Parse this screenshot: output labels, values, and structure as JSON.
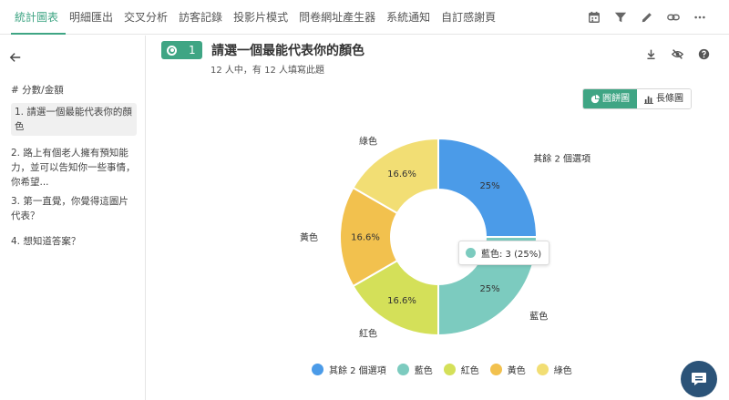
{
  "nav": {
    "tabs": [
      "統計圖表",
      "明細匯出",
      "交叉分析",
      "訪客記錄",
      "投影片模式",
      "問卷網址產生器",
      "系統通知",
      "自訂感謝頁"
    ],
    "active_index": 0,
    "icons": [
      "calendar-icon",
      "filter-icon",
      "pencil-icon",
      "link-icon",
      "more-icon"
    ]
  },
  "sidebar": {
    "items": [
      {
        "num": "#",
        "label": "分數/金額"
      },
      {
        "num": "1.",
        "label": "請選一個最能代表你的顏色",
        "selected": true
      },
      {
        "num": "2.",
        "label": "路上有個老人擁有預知能力，並可以告知你一些事情，你希望..."
      },
      {
        "num": "3.",
        "label": "第一直覺，你覺得這圖片代表？"
      },
      {
        "num": "4.",
        "label": "想知道答案？"
      }
    ]
  },
  "question": {
    "number": "1",
    "title": "請選一個最能代表你的顏色",
    "subtitle": "12 人中，有 12 人填寫此題"
  },
  "view_toggle": {
    "pie_label": "圓餅圖",
    "bar_label": "長條圖",
    "active": "pie"
  },
  "tooltip": {
    "text": "藍色: 3 (25%)",
    "color": "#7ccbbf"
  },
  "chart_data": {
    "type": "pie",
    "donut": true,
    "categories": [
      "其餘 2 個選項",
      "藍色",
      "紅色",
      "黃色",
      "綠色"
    ],
    "values": [
      3,
      3,
      2,
      2,
      2
    ],
    "percent_labels": [
      "25%",
      "25%",
      "16.6%",
      "16.6%",
      "16.6%"
    ],
    "colors": [
      "#4b9be8",
      "#7ccbbf",
      "#d4e059",
      "#f2c14e",
      "#f2de74"
    ],
    "legend_position": "bottom"
  },
  "colors": {
    "accent": "#3fa584",
    "chat_button": "#2b5378"
  }
}
